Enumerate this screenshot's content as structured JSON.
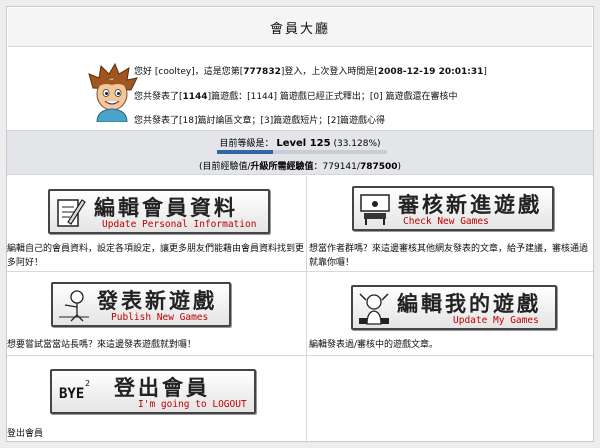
{
  "header": {
    "title": "會員大廳"
  },
  "user": {
    "greet_pre": "您好 [",
    "username": "cooltey",
    "greet_mid": "]，這是您第[",
    "login_count": "777832",
    "greet_post": "]登入，上次登入時間是[",
    "last_login": "2008-12-19 20:01:31",
    "greet_end": "]",
    "games_pre": "您共發表了[",
    "games_total": "1144",
    "games_mid": "]篇遊戲：[1144] 篇遊戲已經正式釋出；[0] 篇遊戲還在審核中",
    "posts_text": "您共發表了[18]篇討論區文章；[3]篇遊戲短片；[2]篇遊戲心得"
  },
  "level": {
    "label": "目前等級是：",
    "value": "Level 125",
    "percent_text": "(33.128%)",
    "progress": 0.33128,
    "exp_open": "(目前經驗值/",
    "exp_need_label": "升級所需經驗值",
    "exp_colon": "：",
    "exp_current": "779141",
    "exp_sep": "/",
    "exp_required": "787500",
    "exp_close": ")"
  },
  "actions": {
    "edit_profile": {
      "title": "編輯會員資料",
      "subtitle": "Update Personal Information",
      "desc": "編輯自己的會員資料，設定各項設定，讓更多朋友們能藉由會員資料找到更多阿好！"
    },
    "check_games": {
      "title": "審核新進遊戲",
      "subtitle": "Check New Games",
      "desc": "想當作者群嗎？來這邊審核其他網友發表的文章，給予建議，審核通過就靠你囉！"
    },
    "publish_game": {
      "title": "發表新遊戲",
      "subtitle": "Publish New Games",
      "desc": "想要嘗試當當站長嗎？來這邊發表遊戲就對囉！"
    },
    "edit_games": {
      "title": "編輯我的遊戲",
      "subtitle": "Update My Games",
      "desc": "編輯發表過/審核中的遊戲文章。"
    },
    "logout": {
      "title": "登出會員",
      "subtitle": "I'm going to LOGOUT",
      "icon_text": "BYE",
      "desc": "登出會員"
    }
  },
  "colors": {
    "subtitle": "#c00000",
    "level_bar": "#3465a4",
    "level_bg": "#e3e5e8"
  },
  "icons": [
    "avatar-boy",
    "pencil-paper-icon",
    "desk-screen-icon",
    "stick-figure-icon",
    "thinking-figure-icon",
    "bye-icon"
  ]
}
